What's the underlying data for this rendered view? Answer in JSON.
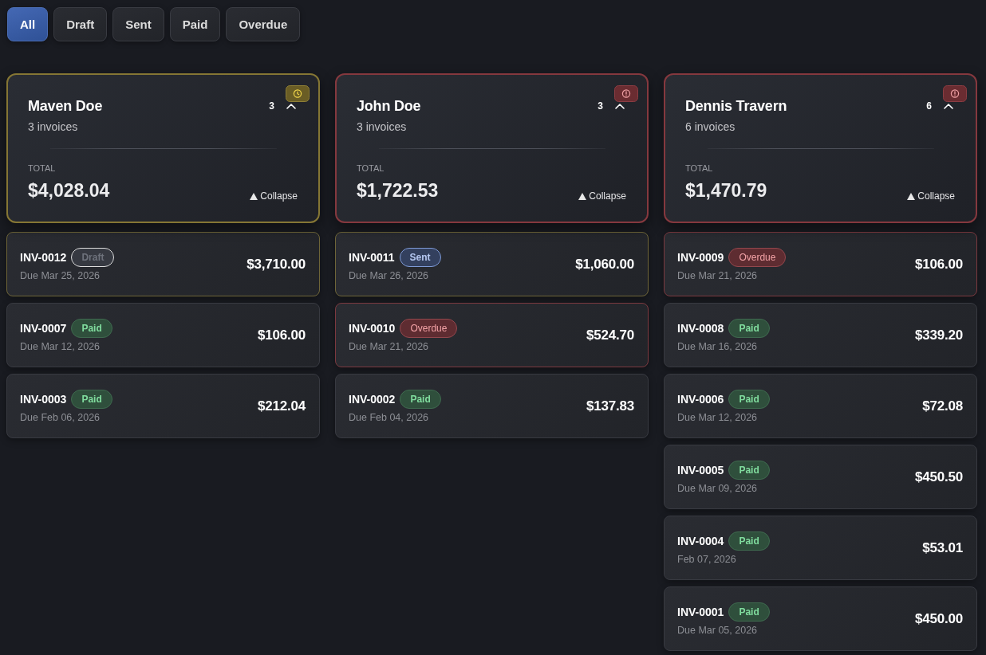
{
  "filter_tabs": [
    {
      "label": "All",
      "selected": true
    },
    {
      "label": "Draft",
      "selected": false
    },
    {
      "label": "Sent",
      "selected": false
    },
    {
      "label": "Paid",
      "selected": false
    },
    {
      "label": "Overdue",
      "selected": false
    }
  ],
  "customer_groups": [
    {
      "name": "Maven Doe",
      "kind": "due_soon",
      "count": "3",
      "expanded": true,
      "invoice_summary": "3 invoices",
      "total_label": "TOTAL",
      "total": "$4,028.04",
      "toggle_label": "Collapse",
      "invoices": [
        {
          "number": "INV-0012",
          "status": {
            "kind": "draft",
            "label": "Draft"
          },
          "due": "Due Mar 25, 2026",
          "amount": "$3,710.00",
          "flagged": true
        },
        {
          "number": "INV-0007",
          "status": {
            "kind": "paid",
            "label": "Paid"
          },
          "due": "Due Mar 12, 2026",
          "amount": "$106.00",
          "flagged": false
        },
        {
          "number": "INV-0003",
          "status": {
            "kind": "paid",
            "label": "Paid"
          },
          "due": "Due Feb 06, 2026",
          "amount": "$212.04",
          "flagged": false
        }
      ]
    },
    {
      "name": "John Doe",
      "kind": "overdue",
      "count": "3",
      "expanded": true,
      "invoice_summary": "3 invoices",
      "total_label": "TOTAL",
      "total": "$1,722.53",
      "toggle_label": "Collapse",
      "invoices": [
        {
          "number": "INV-0011",
          "status": {
            "kind": "sent",
            "label": "Sent"
          },
          "due": "Due Mar 26, 2026",
          "amount": "$1,060.00",
          "flagged": true
        },
        {
          "number": "INV-0010",
          "status": {
            "kind": "overdue",
            "label": "Overdue"
          },
          "due": "Due Mar 21, 2026",
          "amount": "$524.70",
          "flagged": true
        },
        {
          "number": "INV-0002",
          "status": {
            "kind": "paid",
            "label": "Paid"
          },
          "due": "Due Feb 04, 2026",
          "amount": "$137.83",
          "flagged": false
        }
      ]
    },
    {
      "name": "Dennis Travern",
      "kind": "overdue",
      "count": "6",
      "expanded": true,
      "invoice_summary": "6 invoices",
      "total_label": "TOTAL",
      "total": "$1,470.79",
      "toggle_label": "Collapse",
      "invoices": [
        {
          "number": "INV-0009",
          "status": {
            "kind": "overdue",
            "label": "Overdue"
          },
          "due": "Due Mar 21, 2026",
          "amount": "$106.00",
          "flagged": true
        },
        {
          "number": "INV-0008",
          "status": {
            "kind": "paid",
            "label": "Paid"
          },
          "due": "Due Mar 16, 2026",
          "amount": "$339.20",
          "flagged": false
        },
        {
          "number": "INV-0006",
          "status": {
            "kind": "paid",
            "label": "Paid"
          },
          "due": "Due Mar 12, 2026",
          "amount": "$72.08",
          "flagged": false
        },
        {
          "number": "INV-0005",
          "status": {
            "kind": "paid",
            "label": "Paid"
          },
          "due": "Due Mar 09, 2026",
          "amount": "$450.50",
          "flagged": false
        },
        {
          "number": "INV-0004",
          "status": {
            "kind": "paid",
            "label": "Paid"
          },
          "due": "Feb 07, 2026",
          "amount": "$53.01",
          "flagged": false
        },
        {
          "number": "INV-0001",
          "status": {
            "kind": "paid",
            "label": "Paid"
          },
          "due": "Due Mar 05, 2026",
          "amount": "$450.00",
          "flagged": false
        }
      ]
    }
  ]
}
